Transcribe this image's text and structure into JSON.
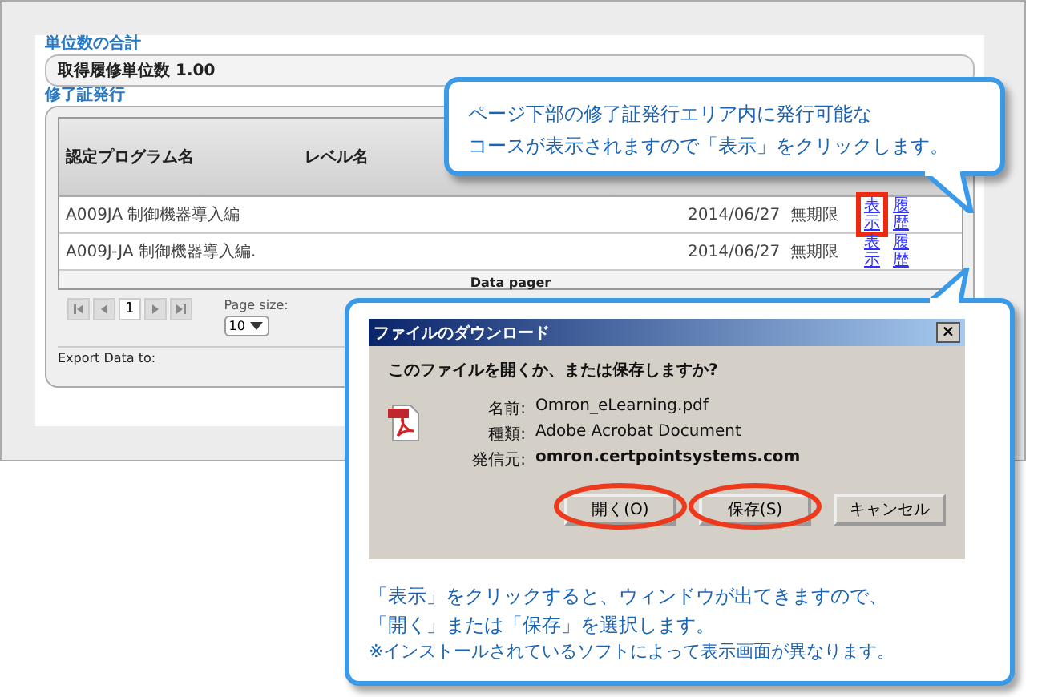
{
  "credits": {
    "title": "単位数の合計",
    "label": "取得履修単位数 1.00"
  },
  "certificates": {
    "title": "修了証発行",
    "columns": [
      "認定プログラム名",
      "レベル名"
    ],
    "rows": [
      {
        "program": "A009JA 制御機器導入編",
        "date": "2014/06/27",
        "expiry": "無期限",
        "links": [
          "表示",
          "履歴"
        ],
        "highlighted": true
      },
      {
        "program": "A009J-JA  制御機器導入編.",
        "date": "2014/06/27",
        "expiry": "無期限",
        "links": [
          "表示",
          "履歴"
        ],
        "highlighted": false
      }
    ],
    "pager": {
      "label": "Data pager",
      "page": "1",
      "page_size_label": "Page size:",
      "page_size": "10"
    },
    "export_label": "Export Data to:"
  },
  "top_callout": {
    "lines": [
      "ページ下部の修了証発行エリア内に発行可能な",
      "コースが表示されますので「表示」をクリックします。"
    ]
  },
  "dialog": {
    "title": "ファイルのダウンロード",
    "close": "×",
    "question": "このファイルを開くか、または保存しますか?",
    "fields": [
      {
        "label": "名前:",
        "value": "Omron_eLearning.pdf",
        "bold": false
      },
      {
        "label": "種類:",
        "value": "Adobe Acrobat Document",
        "bold": false
      },
      {
        "label": "発信元:",
        "value": "omron.certpointsystems.com",
        "bold": true
      }
    ],
    "buttons": [
      {
        "label": "開く(O)",
        "circled": true
      },
      {
        "label": "保存(S)",
        "circled": true
      },
      {
        "label": "キャンセル",
        "circled": false
      }
    ]
  },
  "note": {
    "lines": [
      "「表示」をクリックすると、ウィンドウが出てきますので、",
      "「開く」または「保存」を選択します。"
    ],
    "footnote": "※インストールされているソフトによって表示画面が異なります。"
  }
}
